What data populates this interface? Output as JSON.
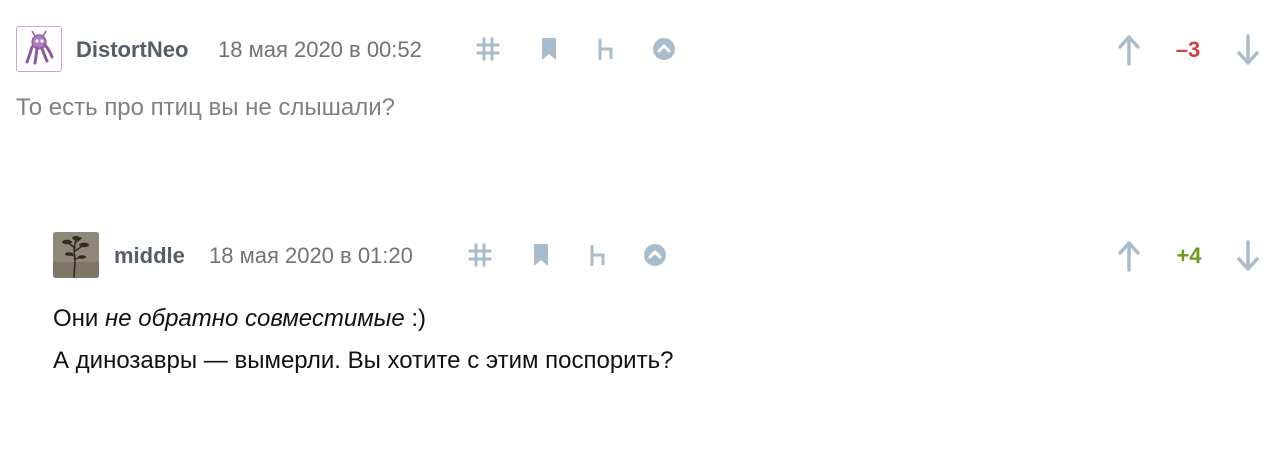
{
  "comments": [
    {
      "author": "DistortNeo",
      "time": "18 мая 2020 в 00:52",
      "score": "–3",
      "text": "То есть про птиц вы не слышали?"
    },
    {
      "author": "middle",
      "time": "18 мая 2020 в 01:20",
      "score": "+4",
      "text_line1_a": "Они ",
      "text_line1_em": "не обратно совместимые",
      "text_line1_b": " :)",
      "text_line2": "А динозавры — вымерли. Вы хотите с этим поспорить?"
    }
  ],
  "icons": {
    "link": "hash-icon",
    "bookmark": "bookmark-icon",
    "reply": "reply-branch-icon",
    "parent": "chevron-up-circle-icon",
    "upvote": "arrow-up-icon",
    "downvote": "arrow-down-icon"
  },
  "colors": {
    "icon": "#a9bccb",
    "negative_score": "#d0403b",
    "positive_score": "#6d9b1f"
  }
}
